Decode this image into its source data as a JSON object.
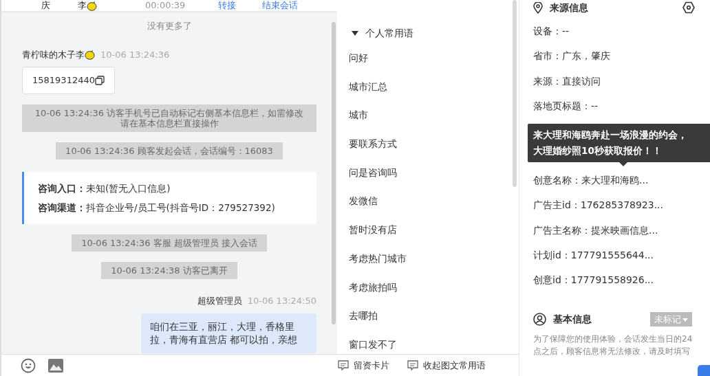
{
  "header": {
    "items": [
      {
        "kind": "text",
        "text": "庆"
      },
      {
        "kind": "text",
        "text": "李"
      },
      {
        "kind": "time",
        "text": "00:00:39"
      },
      {
        "kind": "link",
        "text": "转接"
      },
      {
        "kind": "link",
        "text": "结束会话"
      }
    ]
  },
  "chat": {
    "no_more": "没有更多了",
    "messages": [
      {
        "kind": "visitor",
        "name": "青柠味的木子李",
        "time": "10-06 13:24:36",
        "content": "15819312440"
      },
      {
        "kind": "system",
        "text": "10-06 13:24:36 访客手机号已自动标记右侧基本信息栏，如需修改请在基本信息栏直接操作"
      },
      {
        "kind": "system",
        "text": "10-06 13:24:36 顾客发起会话，会话编号：16083"
      },
      {
        "kind": "info",
        "rows": [
          {
            "label": "咨询入口：",
            "value": "未知(暂无入口信息)"
          },
          {
            "label": "咨询渠道：",
            "value": "抖音企业号/员工号(抖音号ID：279527392)"
          }
        ]
      },
      {
        "kind": "system",
        "text": "10-06 13:24:36 客服 超级管理员 接入会话"
      },
      {
        "kind": "system",
        "text": "10-06 13:24:38 访客已离开"
      },
      {
        "kind": "agent",
        "name": "超级管理员",
        "time": "10-06 13:24:50",
        "content": "咱们在三亚，丽江，大理，香格里拉，青海有直营店 都可以拍，亲想"
      }
    ]
  },
  "phrases": {
    "group": {
      "label": "个人常用语",
      "expanded": true
    },
    "items": [
      "问好",
      "城市汇总",
      "城市",
      "要联系方式",
      "问是咨询吗",
      "发微信",
      "暂时没有店",
      "考虑热门城市",
      "考虑旅拍吗",
      "去哪拍",
      "窗口发不了"
    ],
    "footer": [
      "留资卡片",
      "收起图文常用语"
    ]
  },
  "source": {
    "title": "来源信息",
    "rows": [
      "设备：--",
      "省市：广东，肇庆",
      "来源：直接访问",
      "落地页标题：--"
    ],
    "tooltip": {
      "lines": [
        "来大理和海鸥奔赴一场浪漫的约会，",
        "大理婚纱照10秒获取报价！！"
      ]
    },
    "rows_below": [
      "创意名称：来大理和海鸥...",
      "广告主id：176285378923...",
      "广告主名称：提米映画信息...",
      "计划id：177791555644...",
      "创意id：177791558926..."
    ]
  },
  "basic": {
    "title": "基本信息",
    "tag": "未标记",
    "note": "为了保障您的使用体验，会话发生当日的24点之后，顾客信息将无法修改，请及时填写"
  }
}
